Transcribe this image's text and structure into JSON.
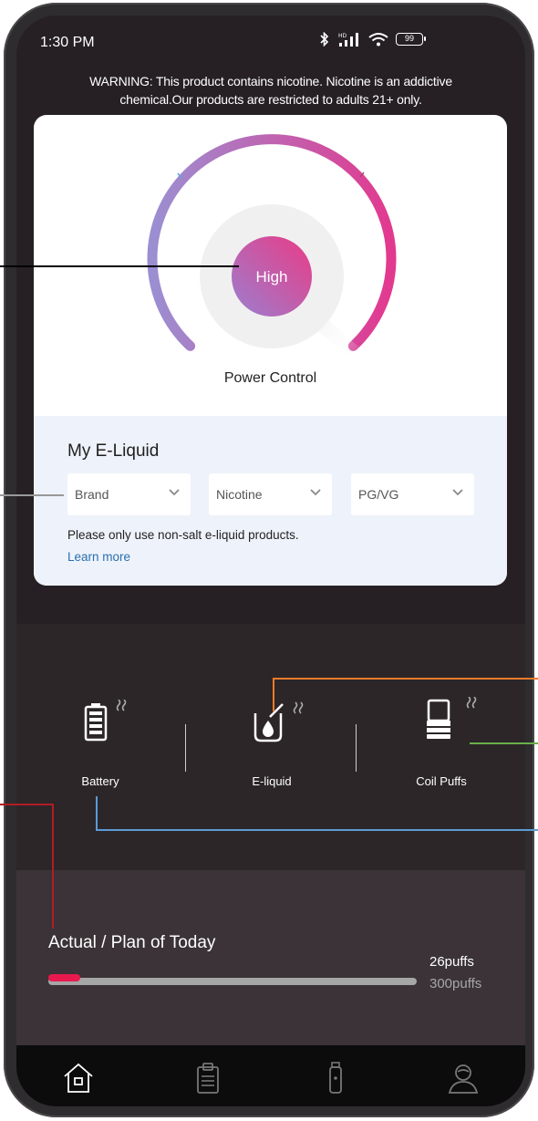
{
  "status_bar": {
    "time": "1:30 PM",
    "battery_level": "99",
    "icons": [
      "bluetooth-icon",
      "hd-signal-icon",
      "wifi-icon",
      "battery-icon"
    ]
  },
  "warning_text": "WARNING: This product contains nicotine. Nicotine is an addictive chemical.Our products are restricted to adults 21+ only.",
  "power_control": {
    "level": "High",
    "label": "Power Control"
  },
  "eliquid": {
    "title": "My E-Liquid",
    "dropdowns": [
      {
        "value": "Brand"
      },
      {
        "value": "Nicotine"
      },
      {
        "value": "PG/VG"
      }
    ],
    "note": "Please only use non-salt e-liquid products.",
    "learn_more": "Learn more"
  },
  "device_status": [
    {
      "label": "Battery",
      "icon": "battery-icon"
    },
    {
      "label": "E-liquid",
      "icon": "e-liquid-icon"
    },
    {
      "label": "Coil Puffs",
      "icon": "coil-icon"
    }
  ],
  "plan": {
    "title": "Actual / Plan of Today",
    "actual": "26puffs",
    "planned": "300puffs",
    "actual_value": 26,
    "planned_value": 300
  },
  "nav": [
    {
      "icon": "home-icon"
    },
    {
      "icon": "clipboard-icon"
    },
    {
      "icon": "device-icon"
    },
    {
      "icon": "profile-icon"
    }
  ],
  "colors": {
    "accent_pink": "#e8194f",
    "gauge_start": "#9b8fd2",
    "gauge_end": "#e2398f",
    "callout_black": "#000000",
    "callout_gray": "#999999",
    "callout_orange": "#f07c2a",
    "callout_green": "#6ab04c",
    "callout_blue": "#5b9bd5",
    "callout_red": "#b01e23"
  }
}
